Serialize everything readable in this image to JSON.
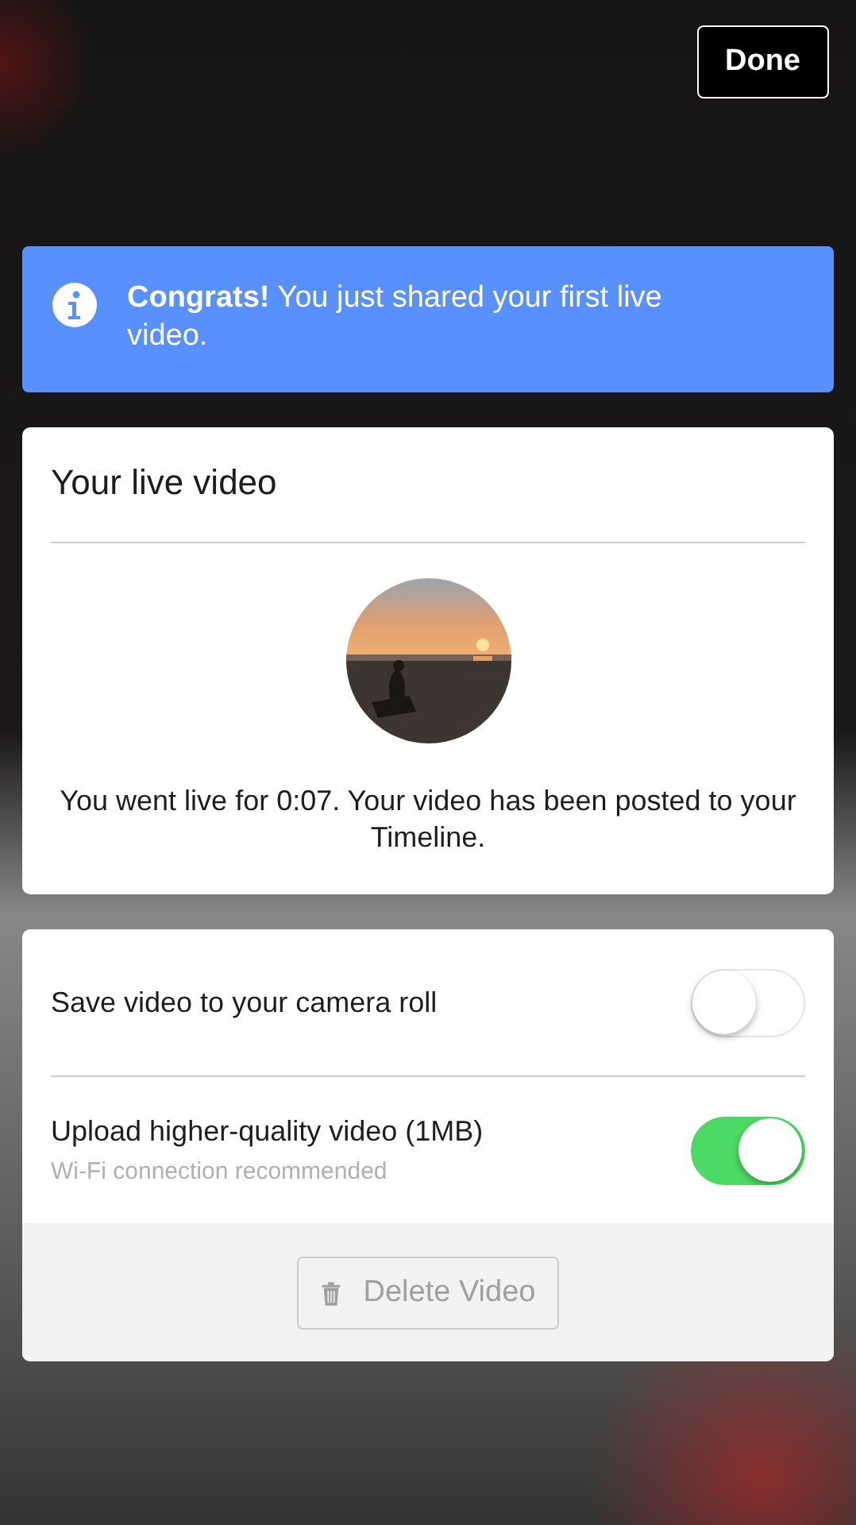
{
  "done_button": "Done",
  "notice": {
    "text": "**Congrats!** You just shared your first live video."
  },
  "live_card": {
    "title": "Your live video",
    "summary": "You went live for 0:07. Your video has been posted to your Timeline."
  },
  "settings": [
    {
      "label": "Save video to your camera roll",
      "on": false
    },
    {
      "label": "Upload higher-quality video (1MB)",
      "hint": "Wi-Fi connection recommended",
      "on": true
    }
  ],
  "delete_button": {
    "label": "Delete Video",
    "disabled": true
  }
}
